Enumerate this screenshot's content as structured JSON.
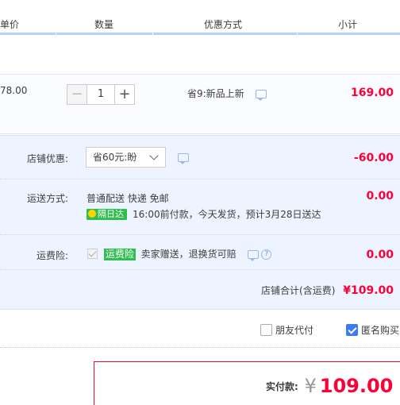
{
  "table_header": {
    "unit_price": "单价",
    "quantity": "数量",
    "discount": "优惠方式",
    "subtotal": "小计"
  },
  "item": {
    "unit_price": "78.00",
    "quantity": "1",
    "minus": "−",
    "plus": "+",
    "promo": "省9:新品上新",
    "subtotal": "169.00"
  },
  "store": {
    "coupon_label": "店铺优惠:",
    "coupon_value": "省60元:盼",
    "coupon_amount": "-60.00",
    "shipping_label": "运送方式:",
    "shipping_method": "普通配送 快递 免邮",
    "shipping_badge": "隔日达",
    "shipping_note": "16:00前付款，今天发货，预计3月28日送达",
    "shipping_amount": "0.00",
    "insurance_label": "运费险:",
    "insurance_badge": "运费险",
    "insurance_note": "卖家赠送，退换货可赔",
    "insurance_help": "?",
    "insurance_amount": "0.00",
    "total_label": "店铺合计(含运费)",
    "total_amount": "¥109.00"
  },
  "options": {
    "friend_pay": "朋友代付",
    "anonymous": "匿名购买"
  },
  "payment": {
    "label": "实付款:",
    "currency": "¥",
    "amount": "109.00"
  },
  "colors": {
    "price_red": "#ff0036",
    "header_border": "#b2d1ff",
    "panel_bg": "#eef4ff",
    "checked_blue": "#3a7bf2",
    "badge_green": "#2fbe4e"
  }
}
